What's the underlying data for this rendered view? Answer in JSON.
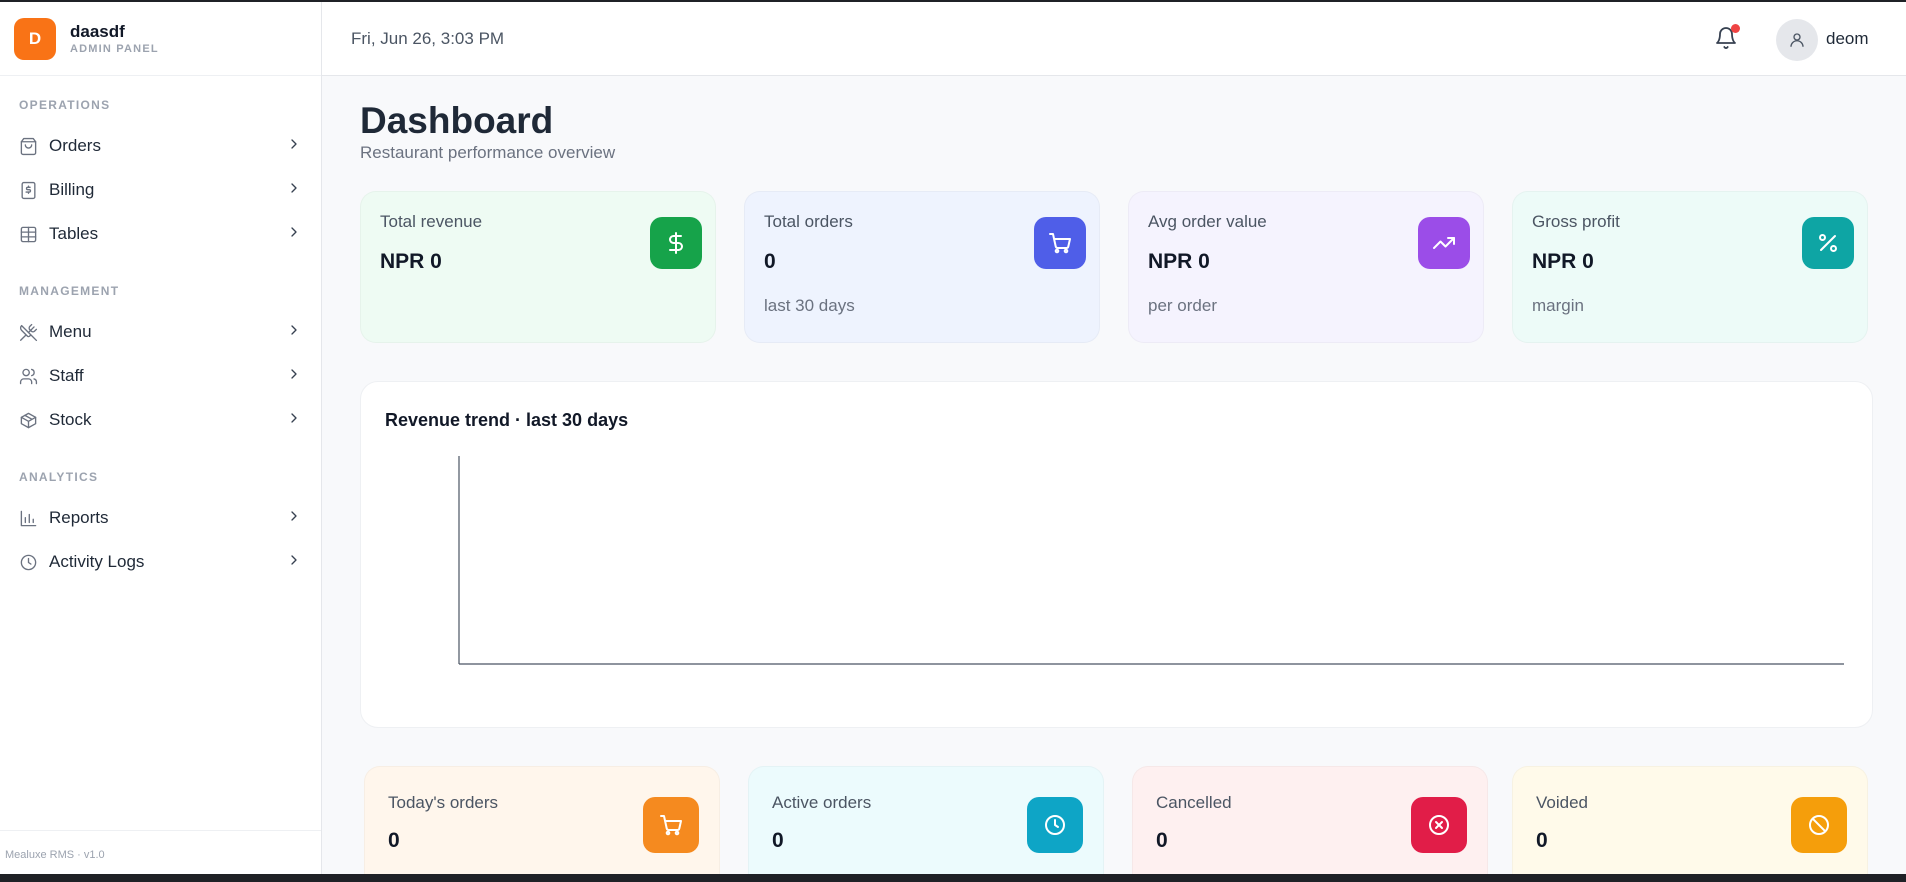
{
  "brand": {
    "initial": "D",
    "name": "daasdf",
    "subtitle": "ADMIN PANEL"
  },
  "sidebar": {
    "sections": [
      {
        "title": "OPERATIONS",
        "items": [
          {
            "label": "Orders",
            "icon": "shopping-bag-icon"
          },
          {
            "label": "Billing",
            "icon": "receipt-icon"
          },
          {
            "label": "Tables",
            "icon": "table-icon"
          }
        ]
      },
      {
        "title": "MANAGEMENT",
        "items": [
          {
            "label": "Menu",
            "icon": "utensils-icon"
          },
          {
            "label": "Staff",
            "icon": "users-icon"
          },
          {
            "label": "Stock",
            "icon": "package-icon"
          }
        ]
      },
      {
        "title": "ANALYTICS",
        "items": [
          {
            "label": "Reports",
            "icon": "bar-chart-icon"
          },
          {
            "label": "Activity Logs",
            "icon": "clock-icon"
          }
        ]
      }
    ],
    "footer": "Mealuxe RMS · v1.0"
  },
  "header": {
    "datetime": "Fri, Jun 26, 3:03 PM",
    "user": "deom",
    "has_notification": true
  },
  "page": {
    "title": "Dashboard",
    "subtitle": "Restaurant performance overview"
  },
  "kpis": [
    {
      "label": "Total revenue",
      "value": "NPR 0",
      "foot": "",
      "icon": "dollar-icon",
      "color": "#16a34a",
      "bg": "#eefbf3"
    },
    {
      "label": "Total orders",
      "value": "0",
      "foot": "last 30 days",
      "icon": "cart-icon",
      "color": "#4f5ee8",
      "bg": "#eef3fe"
    },
    {
      "label": "Avg order value",
      "value": "NPR 0",
      "foot": "per order",
      "icon": "trending-up-icon",
      "color": "#9b4de8",
      "bg": "#f5f3fe"
    },
    {
      "label": "Gross profit",
      "value": "NPR 0",
      "foot": "margin",
      "icon": "percent-icon",
      "color": "#0ea5a4",
      "bg": "#edfbf8"
    }
  ],
  "chart": {
    "title": "Revenue trend · last 30 days"
  },
  "chart_data": {
    "type": "line",
    "title": "Revenue trend · last 30 days",
    "x": [],
    "series": [],
    "xlabel": "",
    "ylabel": "",
    "grid": false
  },
  "stats": [
    {
      "label": "Today's orders",
      "value": "0",
      "icon": "cart-icon",
      "color": "#f58a1f",
      "bg": "#fff6ec"
    },
    {
      "label": "Active orders",
      "value": "0",
      "icon": "clock-icon",
      "color": "#0ea5c6",
      "bg": "#ecfbfd"
    },
    {
      "label": "Cancelled",
      "value": "0",
      "icon": "x-circle-icon",
      "color": "#e11d48",
      "bg": "#fef0f0"
    },
    {
      "label": "Voided",
      "value": "0",
      "icon": "ban-icon",
      "color": "#f59e0b",
      "bg": "#fffaea"
    }
  ]
}
